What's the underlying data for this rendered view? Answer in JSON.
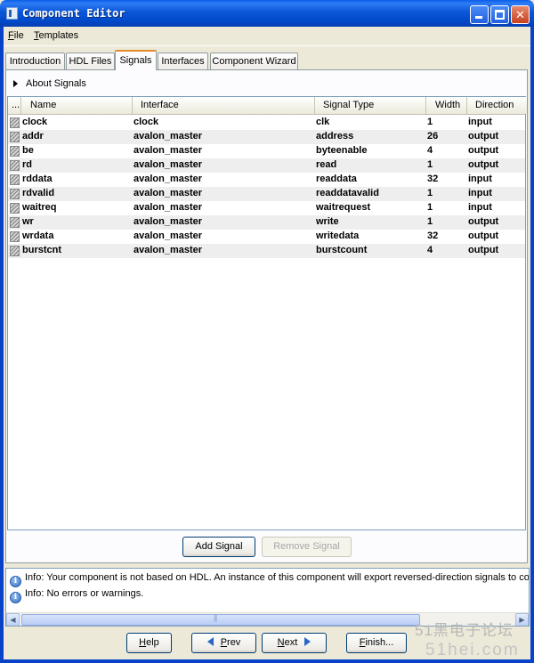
{
  "window": {
    "title": "Component Editor"
  },
  "menu": [
    {
      "label": "File",
      "mnemonic": "F",
      "rest": "ile"
    },
    {
      "label": "Templates",
      "mnemonic": "T",
      "rest": "emplates"
    }
  ],
  "tabs": [
    {
      "label": "Introduction",
      "active": false
    },
    {
      "label": "HDL Files",
      "active": false
    },
    {
      "label": "Signals",
      "active": true
    },
    {
      "label": "Interfaces",
      "active": false
    },
    {
      "label": "Component Wizard",
      "active": false
    }
  ],
  "about": {
    "label": "About Signals"
  },
  "table": {
    "columns": [
      "...",
      "Name",
      "Interface",
      "Signal Type",
      "Width",
      "Direction"
    ],
    "rows": [
      {
        "name": "clock",
        "interface": "clock",
        "signal_type": "clk",
        "width": "1",
        "direction": "input"
      },
      {
        "name": "addr",
        "interface": "avalon_master",
        "signal_type": "address",
        "width": "26",
        "direction": "output"
      },
      {
        "name": "be",
        "interface": "avalon_master",
        "signal_type": "byteenable",
        "width": "4",
        "direction": "output"
      },
      {
        "name": "rd",
        "interface": "avalon_master",
        "signal_type": "read",
        "width": "1",
        "direction": "output"
      },
      {
        "name": "rddata",
        "interface": "avalon_master",
        "signal_type": "readdata",
        "width": "32",
        "direction": "input"
      },
      {
        "name": "rdvalid",
        "interface": "avalon_master",
        "signal_type": "readdatavalid",
        "width": "1",
        "direction": "input"
      },
      {
        "name": "waitreq",
        "interface": "avalon_master",
        "signal_type": "waitrequest",
        "width": "1",
        "direction": "input"
      },
      {
        "name": "wr",
        "interface": "avalon_master",
        "signal_type": "write",
        "width": "1",
        "direction": "output"
      },
      {
        "name": "wrdata",
        "interface": "avalon_master",
        "signal_type": "writedata",
        "width": "32",
        "direction": "output"
      },
      {
        "name": "burstcnt",
        "interface": "avalon_master",
        "signal_type": "burstcount",
        "width": "4",
        "direction": "output"
      }
    ]
  },
  "buttons": {
    "add_signal": "Add Signal",
    "remove_signal": "Remove Signal"
  },
  "messages": [
    "Info: Your component is not based on HDL. An instance of this component will export reversed-direction signals to co",
    "Info: No errors or warnings."
  ],
  "nav": {
    "help": {
      "label": "Help",
      "mnemonic": "H",
      "rest": "elp"
    },
    "prev": {
      "label": "Prev",
      "mnemonic": "P",
      "rest": "rev"
    },
    "next": {
      "label": "Next",
      "mnemonic": "N",
      "rest": "ext"
    },
    "finish": {
      "label": "Finish...",
      "mnemonic": "F",
      "rest": "inish..."
    }
  },
  "watermark": {
    "line1": "51黑电子论坛",
    "line2": "51hei.com"
  },
  "colors": {
    "titlebar": "#0b56d8",
    "active_tab_accent": "#e68b2c",
    "row_alt": "#eeeeee"
  }
}
